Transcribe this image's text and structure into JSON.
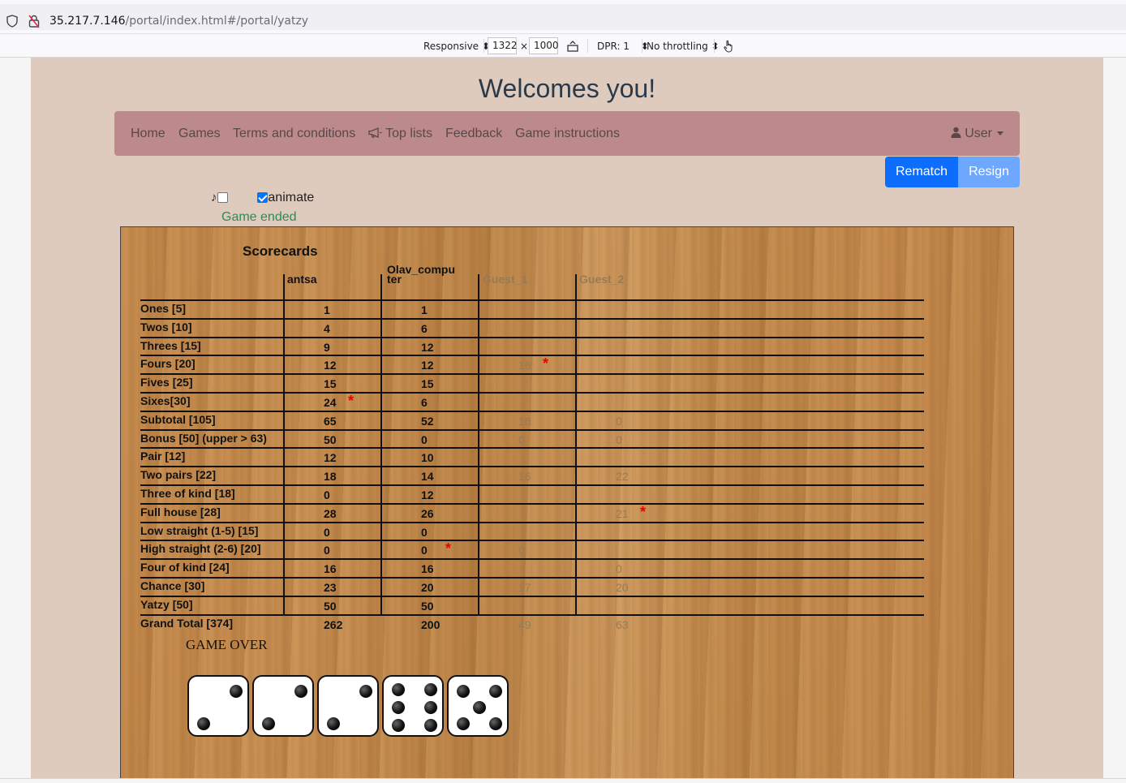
{
  "browser": {
    "url_host": "35.217.7.146",
    "url_path": "/portal/index.html#/portal/yatzy",
    "device_mode": "Responsive",
    "width_value": "1322",
    "times": "×",
    "height_value": "1000",
    "dpr": "DPR: 1",
    "throttling": "No throttling"
  },
  "page": {
    "welcome": "Welcomes you!"
  },
  "nav": {
    "home": "Home",
    "games": "Games",
    "terms": "Terms and conditions",
    "toplists": "Top lists",
    "feedback": "Feedback",
    "instructions": "Game instructions",
    "user": "User"
  },
  "actions": {
    "rematch": "Rematch",
    "resign": "Resign"
  },
  "controls": {
    "sound_checked": false,
    "animate_label": "animate",
    "animate_checked": true,
    "status": "Game ended"
  },
  "scorecard": {
    "title": "Scorecards",
    "players": [
      "antsa",
      "Olav_computer",
      "Guest_1",
      "Guest_2"
    ],
    "player1_head": "antsa",
    "player2_head_line1": "Olav_compu",
    "player2_head_line2": "ter",
    "player3_head": "Guest_1",
    "player4_head": "Guest_2",
    "rows": [
      {
        "label": "Ones [5]",
        "p1": "1",
        "p2": "1",
        "p3": "",
        "p4": ""
      },
      {
        "label": "Twos [10]",
        "p1": "4",
        "p2": "6",
        "p3": "",
        "p4": ""
      },
      {
        "label": "Threes [15]",
        "p1": "9",
        "p2": "12",
        "p3": "",
        "p4": ""
      },
      {
        "label": "Fours [20]",
        "p1": "12",
        "p2": "12",
        "p3": "16",
        "p4": ""
      },
      {
        "label": "Fives [25]",
        "p1": "15",
        "p2": "15",
        "p3": "",
        "p4": ""
      },
      {
        "label": "Sixes[30]",
        "p1": "24",
        "p2": "6",
        "p3": "",
        "p4": ""
      },
      {
        "label": "Subtotal [105]",
        "p1": "65",
        "p2": "52",
        "p3": "16",
        "p4": "0"
      },
      {
        "label": "Bonus [50] (upper > 63)",
        "p1": "50",
        "p2": "0",
        "p3": "0",
        "p4": "0"
      },
      {
        "label": "Pair [12]",
        "p1": "12",
        "p2": "10",
        "p3": "",
        "p4": ""
      },
      {
        "label": "Two pairs [22]",
        "p1": "18",
        "p2": "14",
        "p3": "16",
        "p4": "22"
      },
      {
        "label": "Three of kind [18]",
        "p1": "0",
        "p2": "12",
        "p3": "",
        "p4": ""
      },
      {
        "label": "Full house [28]",
        "p1": "28",
        "p2": "26",
        "p3": "",
        "p4": "21"
      },
      {
        "label": "Low straight (1-5) [15]",
        "p1": "0",
        "p2": "0",
        "p3": "",
        "p4": ""
      },
      {
        "label": "High straight (2-6) [20]",
        "p1": "0",
        "p2": "0",
        "p3": "0",
        "p4": ""
      },
      {
        "label": "Four of kind [24]",
        "p1": "16",
        "p2": "16",
        "p3": "",
        "p4": "0"
      },
      {
        "label": "Chance [30]",
        "p1": "23",
        "p2": "20",
        "p3": "17",
        "p4": "20"
      },
      {
        "label": "Yatzy [50]",
        "p1": "50",
        "p2": "50",
        "p3": "",
        "p4": ""
      },
      {
        "label": "Grand Total [374]",
        "p1": "262",
        "p2": "200",
        "p3": "49",
        "p4": "63"
      }
    ],
    "last_move_markers": [
      {
        "row": "Fours [20]",
        "player": "Guest_1"
      },
      {
        "row": "Sixes[30]",
        "player": "antsa"
      },
      {
        "row": "Full house [28]",
        "player": "Guest_2"
      },
      {
        "row": "High straight (2-6) [20]",
        "player": "Olav_computer"
      }
    ],
    "marker_symbol": "*",
    "game_over": "GAME OVER"
  },
  "dice": [
    2,
    2,
    2,
    6,
    5
  ],
  "colors": {
    "navbar": "#bc8a8a",
    "rematch": "#0d6efd",
    "resign": "#6ea8fe",
    "status": "#2e8b57",
    "marker": "#e00000"
  }
}
